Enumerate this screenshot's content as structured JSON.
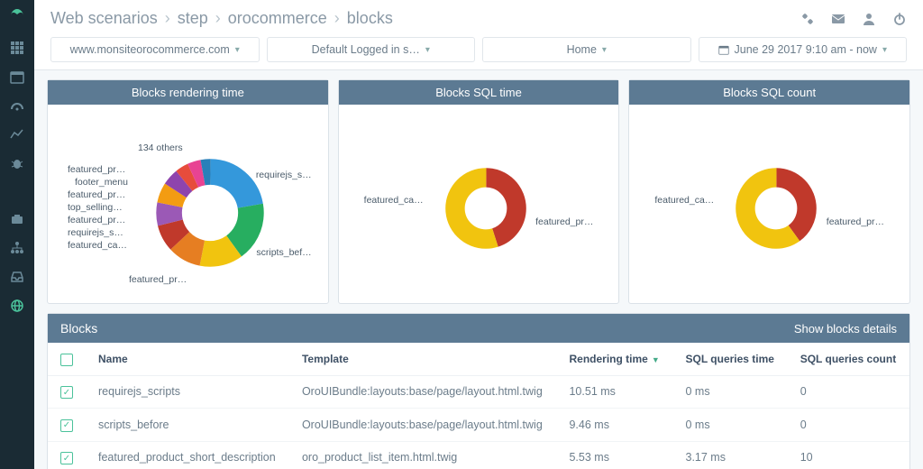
{
  "breadcrumb": [
    "Web scenarios",
    "step",
    "orocommerce",
    "blocks"
  ],
  "filters": {
    "site": "www.monsiteorocommerce.com",
    "user": "Default Logged in s…",
    "page": "Home",
    "daterange": "June 29 2017 9:10 am - now"
  },
  "panels": {
    "render": {
      "title": "Blocks rendering time"
    },
    "sql_time": {
      "title": "Blocks SQL time"
    },
    "sql_count": {
      "title": "Blocks SQL count"
    }
  },
  "blocks_table": {
    "title": "Blocks",
    "details_label": "Show blocks details",
    "headers": {
      "name": "Name",
      "template": "Template",
      "render": "Rendering time",
      "sql_time": "SQL queries time",
      "sql_count": "SQL queries count"
    },
    "rows": [
      {
        "checked": true,
        "name": "requirejs_scripts",
        "template": "OroUIBundle:layouts:base/page/layout.html.twig",
        "render": "10.51 ms",
        "sql_time": "0 ms",
        "sql_count": "0"
      },
      {
        "checked": true,
        "name": "scripts_before",
        "template": "OroUIBundle:layouts:base/page/layout.html.twig",
        "render": "9.46 ms",
        "sql_time": "0 ms",
        "sql_count": "0"
      },
      {
        "checked": true,
        "name": "featured_product_short_description",
        "template": "oro_product_list_item.html.twig",
        "render": "5.53 ms",
        "sql_time": "3.17 ms",
        "sql_count": "10"
      }
    ]
  },
  "chart_data": [
    {
      "type": "donut",
      "title": "Blocks rendering time",
      "series": [
        {
          "name": "requirejs_s…",
          "value": 22,
          "color": "#3498db"
        },
        {
          "name": "scripts_bef…",
          "value": 18,
          "color": "#27ae60"
        },
        {
          "name": "featured_pr…",
          "value": 13,
          "color": "#f1c40f"
        },
        {
          "name": "featured_ca…",
          "value": 10,
          "color": "#e67e22"
        },
        {
          "name": "requirejs_s…",
          "value": 8,
          "color": "#c0392b"
        },
        {
          "name": "featured_pr…",
          "value": 7,
          "color": "#9b59b6"
        },
        {
          "name": "top_selling…",
          "value": 6,
          "color": "#f39c12"
        },
        {
          "name": "featured_pr…",
          "value": 5,
          "color": "#8e44ad"
        },
        {
          "name": "footer_menu",
          "value": 4,
          "color": "#e74c3c"
        },
        {
          "name": "featured_pr…",
          "value": 4,
          "color": "#e84393"
        },
        {
          "name": "134 others",
          "value": 3,
          "color": "#2980b9"
        }
      ]
    },
    {
      "type": "donut",
      "title": "Blocks SQL time",
      "series": [
        {
          "name": "featured_ca…",
          "value": 45,
          "color": "#c0392b"
        },
        {
          "name": "featured_pr…",
          "value": 55,
          "color": "#f1c40f"
        }
      ]
    },
    {
      "type": "donut",
      "title": "Blocks SQL count",
      "series": [
        {
          "name": "featured_ca…",
          "value": 40,
          "color": "#c0392b"
        },
        {
          "name": "featured_pr…",
          "value": 60,
          "color": "#f1c40f"
        }
      ]
    }
  ]
}
